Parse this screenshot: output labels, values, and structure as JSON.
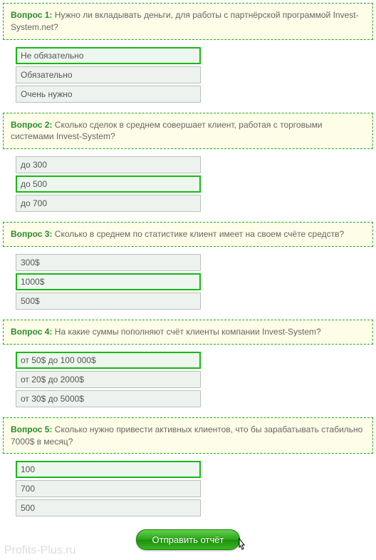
{
  "questions": [
    {
      "label": "Вопрос 1:",
      "text": "Нужно ли вкладывать деньги, для работы с партнёрской программой Invest-System.net?",
      "answers": [
        "Не обязательно",
        "Обязательно",
        "Очень нужно"
      ],
      "selected": 0
    },
    {
      "label": "Вопрос 2:",
      "text": "Сколько сделок в среднем совершает клиент, работая с торговыми системами Invest-System?",
      "answers": [
        "до 300",
        "до 500",
        "до 700"
      ],
      "selected": 1
    },
    {
      "label": "Вопрос 3:",
      "text": "Сколько в среднем по статистике клиент имеет на своем счёте средств?",
      "answers": [
        "300$",
        "1000$",
        "500$"
      ],
      "selected": 1
    },
    {
      "label": "Вопрос 4:",
      "text": "На какие суммы пополняют счёт клиенты компании Invest-System?",
      "answers": [
        "от 50$ до 100 000$",
        "от 20$ до 2000$",
        "от 30$ до 5000$"
      ],
      "selected": 0
    },
    {
      "label": "Вопрос 5:",
      "text": "Сколько нужно привести активных клиентов, что бы зарабатывать стабильно 7000$ в месяц?",
      "answers": [
        "100",
        "700",
        "500"
      ],
      "selected": 0
    }
  ],
  "submit_label": "Отправить отчёт",
  "watermark": "Profits-Plus.ru"
}
